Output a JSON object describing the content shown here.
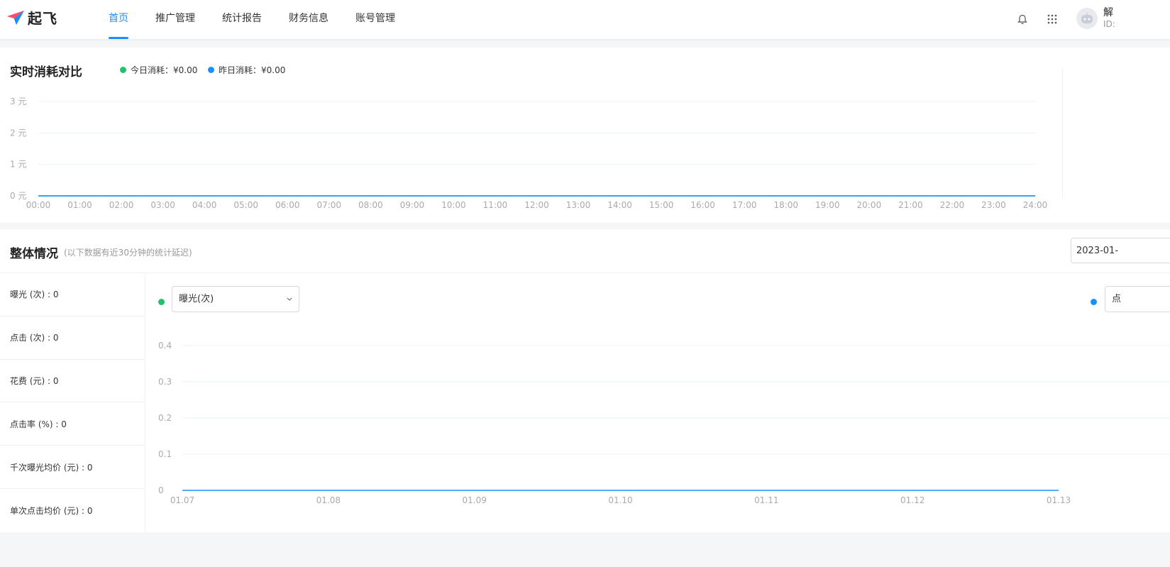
{
  "header": {
    "logo_text": "起飞",
    "nav": [
      {
        "label": "首页",
        "active": true
      },
      {
        "label": "推广管理",
        "active": false
      },
      {
        "label": "统计报告",
        "active": false
      },
      {
        "label": "财务信息",
        "active": false
      },
      {
        "label": "账号管理",
        "active": false
      }
    ],
    "icons": [
      "bell-icon",
      "grid-apps-icon"
    ],
    "user": {
      "name": "解",
      "id_prefix": "ID:"
    }
  },
  "realtime": {
    "title": "实时消耗对比",
    "legend": [
      {
        "label": "今日消耗：¥0.00",
        "color": "#23c16b"
      },
      {
        "label": "昨日消耗：¥0.00",
        "color": "#1890ff"
      }
    ]
  },
  "overview": {
    "title": "整体情况",
    "note": "(以下数据有近30分钟的统计延迟)",
    "date_value": "2023-01-",
    "metrics": [
      "曝光 (次) : 0",
      "点击 (次) : 0",
      "花费 (元) : 0",
      "点击率 (%) : 0",
      "千次曝光均价 (元) : 0",
      "单次点击均价 (元) : 0"
    ],
    "select_left": {
      "value": "曝光(次)",
      "dot_color": "#23c16b"
    },
    "select_right": {
      "value": "点",
      "dot_color": "#1890ff"
    }
  },
  "chart_data": [
    {
      "type": "line",
      "title": "实时消耗对比",
      "x": [
        "00:00",
        "01:00",
        "02:00",
        "03:00",
        "04:00",
        "05:00",
        "06:00",
        "07:00",
        "08:00",
        "09:00",
        "10:00",
        "11:00",
        "12:00",
        "13:00",
        "14:00",
        "15:00",
        "16:00",
        "17:00",
        "18:00",
        "19:00",
        "20:00",
        "21:00",
        "22:00",
        "23:00",
        "24:00"
      ],
      "y_ticks": [
        "0 元",
        "1 元",
        "2 元",
        "3 元"
      ],
      "ylim": [
        0,
        3
      ],
      "grid": true,
      "series": [
        {
          "name": "今日消耗",
          "color": "#23c16b",
          "values": [
            0,
            0,
            0,
            0,
            0,
            0,
            0,
            0,
            0,
            0,
            0,
            0,
            0,
            0,
            0,
            0,
            0,
            0,
            0,
            0,
            0,
            0,
            0,
            0,
            0
          ]
        },
        {
          "name": "昨日消耗",
          "color": "#1890ff",
          "values": [
            0,
            0,
            0,
            0,
            0,
            0,
            0,
            0,
            0,
            0,
            0,
            0,
            0,
            0,
            0,
            0,
            0,
            0,
            0,
            0,
            0,
            0,
            0,
            0,
            0
          ]
        }
      ]
    },
    {
      "type": "line",
      "x": [
        "01.07",
        "01.08",
        "01.09",
        "01.10",
        "01.11",
        "01.12",
        "01.13"
      ],
      "y_ticks": [
        "0",
        "0.1",
        "0.2",
        "0.3",
        "0.4"
      ],
      "ylim": [
        0,
        0.4
      ],
      "grid": true,
      "series": [
        {
          "color": "#1890ff",
          "values": [
            0,
            0,
            0,
            0,
            0,
            0,
            0
          ]
        }
      ]
    }
  ]
}
